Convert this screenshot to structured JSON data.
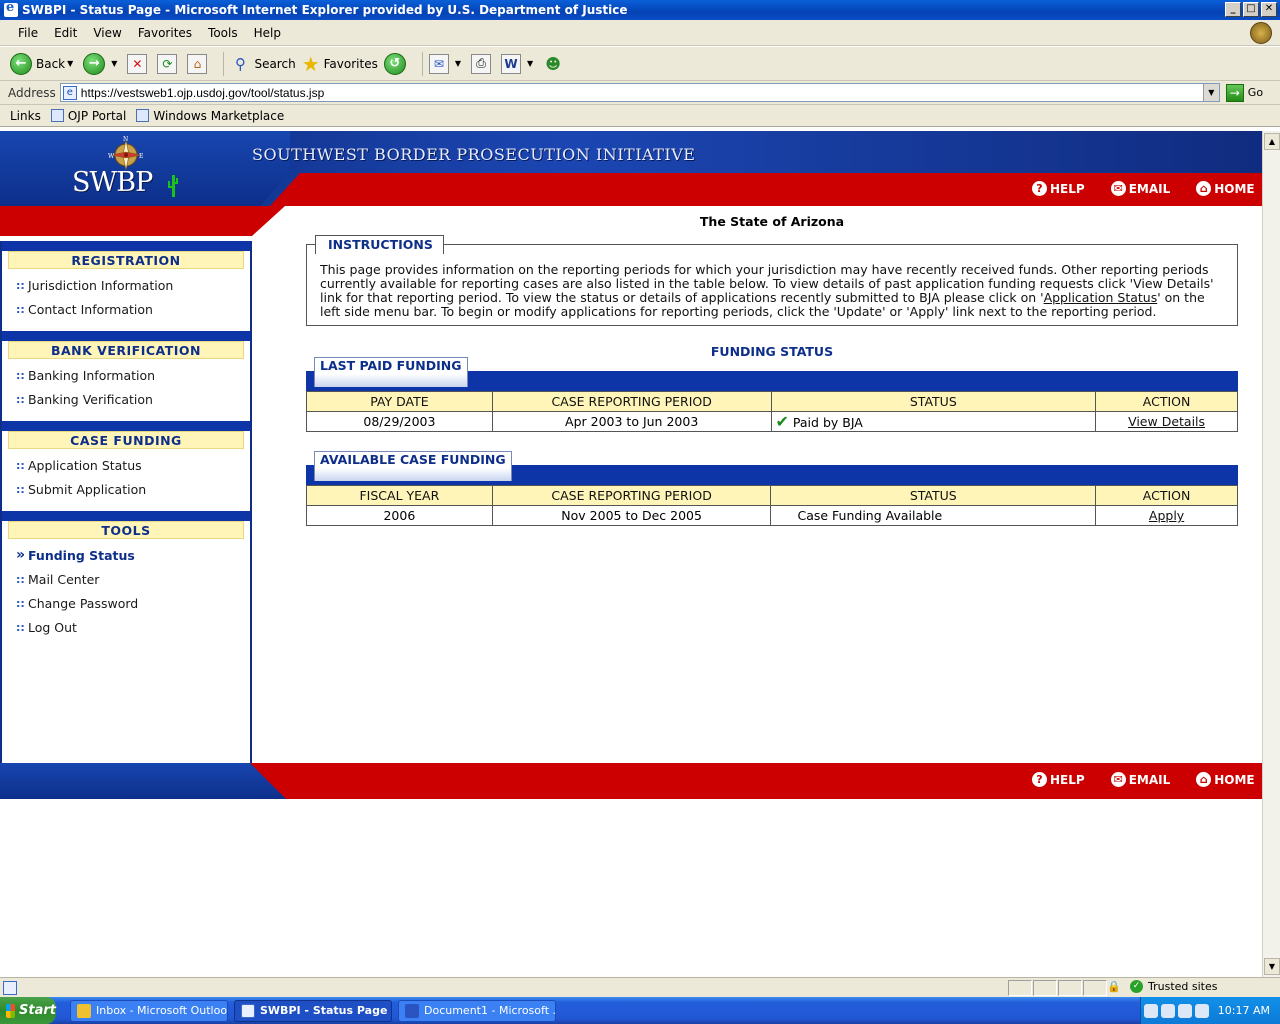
{
  "window": {
    "title": "SWBPI - Status Page - Microsoft Internet Explorer provided by U.S. Department of Justice",
    "btn_min": "_",
    "btn_max": "□",
    "btn_close": "✕"
  },
  "menubar": {
    "items": [
      "File",
      "Edit",
      "View",
      "Favorites",
      "Tools",
      "Help"
    ]
  },
  "toolbar": {
    "back_label": "Back",
    "search_label": "Search",
    "favorites_label": "Favorites"
  },
  "address": {
    "label": "Address",
    "url": "https://vestsweb1.ojp.usdoj.gov/tool/status.jsp",
    "go_label": "Go"
  },
  "links": {
    "label": "Links",
    "items": [
      "OJP Portal",
      "Windows Marketplace"
    ]
  },
  "site": {
    "title": "SOUTHWEST BORDER PROSECUTION INITIATIVE",
    "logo_text": "SWBP",
    "compass_n": "N",
    "compass_w": "W",
    "compass_e": "E",
    "nav": {
      "help": "HELP",
      "email": "EMAIL",
      "home": "HOME"
    }
  },
  "sidebar": {
    "sections": [
      {
        "heading": "REGISTRATION",
        "items": [
          "Jurisdiction Information",
          "Contact Information"
        ]
      },
      {
        "heading": "BANK VERIFICATION",
        "items": [
          "Banking Information",
          "Banking Verification"
        ]
      },
      {
        "heading": "CASE FUNDING",
        "items": [
          "Application Status",
          "Submit Application"
        ]
      },
      {
        "heading": "TOOLS",
        "items": [
          "Funding Status",
          "Mail Center",
          "Change Password",
          "Log Out"
        ]
      }
    ],
    "bullet": "::",
    "active_bullet": "»"
  },
  "main": {
    "state_name": "The State of Arizona",
    "instructions": {
      "title": "INSTRUCTIONS",
      "text_part1": "This page provides information on the reporting periods for which your jurisdiction may have recently received funds. Other reporting periods currently available for reporting cases are also listed in the table below. To view details of past application funding requests click 'View Details' link for that reporting period. To view the status or details of applications recently submitted to BJA please click on '",
      "link_text": "Application Status",
      "text_part2": "' on the left side menu bar. To begin or modify applications for reporting periods, click the 'Update' or 'Apply' link next to the reporting period."
    },
    "funding_status_title": "FUNDING STATUS",
    "last_paid": {
      "title": "LAST PAID FUNDING",
      "headers": [
        "PAY DATE",
        "CASE REPORTING PERIOD",
        "STATUS",
        "ACTION"
      ],
      "row": {
        "date": "08/29/2003",
        "period": "Apr 2003 to Jun 2003",
        "status": "Paid by BJA",
        "action": "View Details"
      }
    },
    "available": {
      "title": "AVAILABLE CASE FUNDING",
      "headers": [
        "FISCAL YEAR",
        "CASE REPORTING PERIOD",
        "STATUS",
        "ACTION"
      ],
      "row": {
        "year": "2006",
        "period": "Nov 2005 to Dec 2005",
        "status": "Case Funding Available",
        "action": "Apply"
      }
    }
  },
  "statusbar": {
    "zone": "Trusted sites"
  },
  "taskbar": {
    "start": "Start",
    "tasks": [
      "Inbox - Microsoft Outlook",
      "SWBPI - Status Page ...",
      "Document1 - Microsoft ..."
    ],
    "clock": "10:17 AM"
  }
}
